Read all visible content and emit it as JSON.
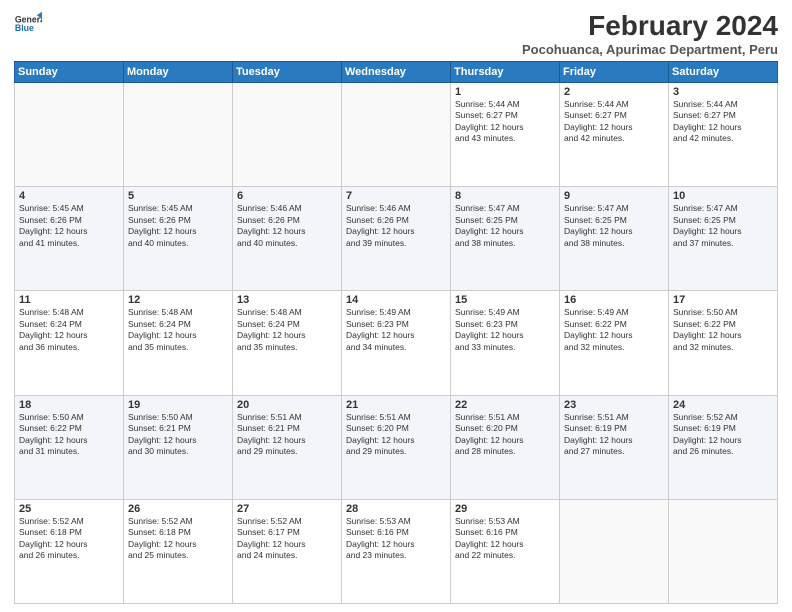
{
  "logo": {
    "text_general": "General",
    "text_blue": "Blue"
  },
  "header": {
    "title": "February 2024",
    "subtitle": "Pocohuanca, Apurimac Department, Peru"
  },
  "days_of_week": [
    "Sunday",
    "Monday",
    "Tuesday",
    "Wednesday",
    "Thursday",
    "Friday",
    "Saturday"
  ],
  "weeks": [
    [
      {
        "day": "",
        "info": ""
      },
      {
        "day": "",
        "info": ""
      },
      {
        "day": "",
        "info": ""
      },
      {
        "day": "",
        "info": ""
      },
      {
        "day": "1",
        "info": "Sunrise: 5:44 AM\nSunset: 6:27 PM\nDaylight: 12 hours\nand 43 minutes."
      },
      {
        "day": "2",
        "info": "Sunrise: 5:44 AM\nSunset: 6:27 PM\nDaylight: 12 hours\nand 42 minutes."
      },
      {
        "day": "3",
        "info": "Sunrise: 5:44 AM\nSunset: 6:27 PM\nDaylight: 12 hours\nand 42 minutes."
      }
    ],
    [
      {
        "day": "4",
        "info": "Sunrise: 5:45 AM\nSunset: 6:26 PM\nDaylight: 12 hours\nand 41 minutes."
      },
      {
        "day": "5",
        "info": "Sunrise: 5:45 AM\nSunset: 6:26 PM\nDaylight: 12 hours\nand 40 minutes."
      },
      {
        "day": "6",
        "info": "Sunrise: 5:46 AM\nSunset: 6:26 PM\nDaylight: 12 hours\nand 40 minutes."
      },
      {
        "day": "7",
        "info": "Sunrise: 5:46 AM\nSunset: 6:26 PM\nDaylight: 12 hours\nand 39 minutes."
      },
      {
        "day": "8",
        "info": "Sunrise: 5:47 AM\nSunset: 6:25 PM\nDaylight: 12 hours\nand 38 minutes."
      },
      {
        "day": "9",
        "info": "Sunrise: 5:47 AM\nSunset: 6:25 PM\nDaylight: 12 hours\nand 38 minutes."
      },
      {
        "day": "10",
        "info": "Sunrise: 5:47 AM\nSunset: 6:25 PM\nDaylight: 12 hours\nand 37 minutes."
      }
    ],
    [
      {
        "day": "11",
        "info": "Sunrise: 5:48 AM\nSunset: 6:24 PM\nDaylight: 12 hours\nand 36 minutes."
      },
      {
        "day": "12",
        "info": "Sunrise: 5:48 AM\nSunset: 6:24 PM\nDaylight: 12 hours\nand 35 minutes."
      },
      {
        "day": "13",
        "info": "Sunrise: 5:48 AM\nSunset: 6:24 PM\nDaylight: 12 hours\nand 35 minutes."
      },
      {
        "day": "14",
        "info": "Sunrise: 5:49 AM\nSunset: 6:23 PM\nDaylight: 12 hours\nand 34 minutes."
      },
      {
        "day": "15",
        "info": "Sunrise: 5:49 AM\nSunset: 6:23 PM\nDaylight: 12 hours\nand 33 minutes."
      },
      {
        "day": "16",
        "info": "Sunrise: 5:49 AM\nSunset: 6:22 PM\nDaylight: 12 hours\nand 32 minutes."
      },
      {
        "day": "17",
        "info": "Sunrise: 5:50 AM\nSunset: 6:22 PM\nDaylight: 12 hours\nand 32 minutes."
      }
    ],
    [
      {
        "day": "18",
        "info": "Sunrise: 5:50 AM\nSunset: 6:22 PM\nDaylight: 12 hours\nand 31 minutes."
      },
      {
        "day": "19",
        "info": "Sunrise: 5:50 AM\nSunset: 6:21 PM\nDaylight: 12 hours\nand 30 minutes."
      },
      {
        "day": "20",
        "info": "Sunrise: 5:51 AM\nSunset: 6:21 PM\nDaylight: 12 hours\nand 29 minutes."
      },
      {
        "day": "21",
        "info": "Sunrise: 5:51 AM\nSunset: 6:20 PM\nDaylight: 12 hours\nand 29 minutes."
      },
      {
        "day": "22",
        "info": "Sunrise: 5:51 AM\nSunset: 6:20 PM\nDaylight: 12 hours\nand 28 minutes."
      },
      {
        "day": "23",
        "info": "Sunrise: 5:51 AM\nSunset: 6:19 PM\nDaylight: 12 hours\nand 27 minutes."
      },
      {
        "day": "24",
        "info": "Sunrise: 5:52 AM\nSunset: 6:19 PM\nDaylight: 12 hours\nand 26 minutes."
      }
    ],
    [
      {
        "day": "25",
        "info": "Sunrise: 5:52 AM\nSunset: 6:18 PM\nDaylight: 12 hours\nand 26 minutes."
      },
      {
        "day": "26",
        "info": "Sunrise: 5:52 AM\nSunset: 6:18 PM\nDaylight: 12 hours\nand 25 minutes."
      },
      {
        "day": "27",
        "info": "Sunrise: 5:52 AM\nSunset: 6:17 PM\nDaylight: 12 hours\nand 24 minutes."
      },
      {
        "day": "28",
        "info": "Sunrise: 5:53 AM\nSunset: 6:16 PM\nDaylight: 12 hours\nand 23 minutes."
      },
      {
        "day": "29",
        "info": "Sunrise: 5:53 AM\nSunset: 6:16 PM\nDaylight: 12 hours\nand 22 minutes."
      },
      {
        "day": "",
        "info": ""
      },
      {
        "day": "",
        "info": ""
      }
    ]
  ]
}
